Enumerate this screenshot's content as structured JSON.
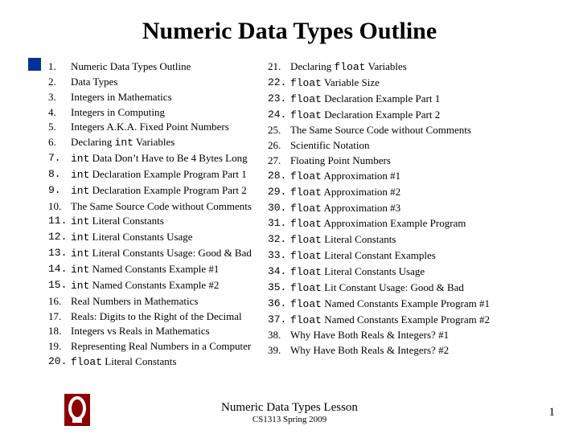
{
  "title": "Numeric Data Types Outline",
  "left_start": 1,
  "left": [
    "Numeric Data Types Outline",
    "Data Types",
    "Integers in Mathematics",
    "Integers in Computing",
    "Integers A.K.A. Fixed Point Numbers",
    "Declaring <code>int</code> Variables",
    "<code>int</code> Data Don’t Have to Be 4 Bytes Long",
    "<code>int</code> Declaration Example Program Part 1",
    "<code>int</code> Declaration Example Program Part 2",
    "The Same Source Code without Comments",
    "<code>int</code> Literal Constants",
    "<code>int</code> Literal Constants Usage",
    "<code>int</code> Literal Constants Usage: Good & Bad",
    "<code>int</code> Named Constants Example #1",
    "<code>int</code> Named Constants Example #2",
    "Real Numbers in Mathematics",
    "Reals: Digits to the Right of the Decimal",
    "Integers vs Reals in Mathematics",
    "Representing Real Numbers in a Computer",
    "<code>float</code> Literal Constants"
  ],
  "right_start": 21,
  "right": [
    "Declaring <code>float</code> Variables",
    "<code>float</code> Variable Size",
    "<code>float</code> Declaration Example Part 1",
    "<code>float</code> Declaration Example Part 2",
    "The Same Source Code without Comments",
    "Scientific Notation",
    "Floating Point Numbers",
    "<code>float</code> Approximation #1",
    "<code>float</code> Approximation #2",
    "<code>float</code> Approximation #3",
    "<code>float</code> Approximation Example Program",
    "<code>float</code> Literal Constants",
    "<code>float</code> Literal Constant Examples",
    "<code>float</code> Literal Constants Usage",
    "<code>float</code> Lit Constant Usage: Good & Bad",
    "<code>float</code> Named Constants Example Program #1",
    "<code>float</code> Named Constants Example Program #2",
    "Why Have Both Reals & Integers? #1",
    "Why Have Both Reals & Integers? #2"
  ],
  "mono_num_left": [
    false,
    false,
    false,
    false,
    false,
    false,
    true,
    true,
    true,
    false,
    true,
    true,
    true,
    true,
    true,
    false,
    false,
    false,
    false,
    true
  ],
  "mono_num_right": [
    false,
    true,
    true,
    true,
    false,
    false,
    false,
    true,
    true,
    true,
    true,
    true,
    true,
    true,
    true,
    true,
    true,
    false,
    false
  ],
  "footer": {
    "lesson": "Numeric Data Types Lesson",
    "course": "CS1313 Spring 2009",
    "page": "1"
  }
}
